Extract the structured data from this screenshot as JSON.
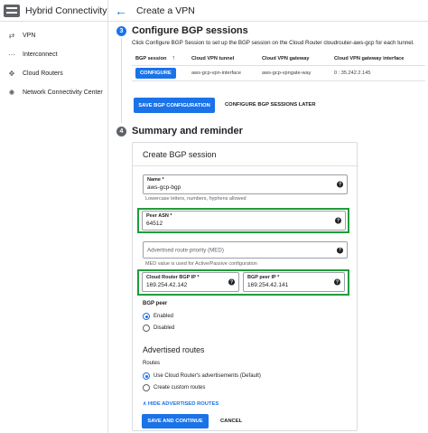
{
  "sidebar": {
    "title": "Hybrid Connectivity",
    "items": [
      {
        "label": "VPN",
        "icon": "vpn-icon"
      },
      {
        "label": "Interconnect",
        "icon": "interconnect-icon"
      },
      {
        "label": "Cloud Routers",
        "icon": "cloud-router-icon"
      },
      {
        "label": "Network Connectivity Center",
        "icon": "network-center-icon"
      }
    ]
  },
  "topbar": {
    "title": "Create a VPN"
  },
  "step3": {
    "number": "3",
    "title": "Configure BGP sessions",
    "description": "Click Configure BGP Session to set up the BGP session on the Cloud Router cloudrouter-aws-gcp for each tunnel.",
    "table": {
      "headers": [
        "BGP session",
        "Cloud VPN tunnel",
        "Cloud VPN gateway",
        "Cloud VPN gateway interface"
      ],
      "rows": [
        {
          "action": "CONFIGURE",
          "tunnel": "aws-gcp-vpn-interface",
          "gateway": "aws-gcp-vpngate-way",
          "interface": "0 : 35.242.2.145"
        }
      ]
    },
    "save_label": "SAVE BGP CONFIGURATION",
    "later_label": "CONFIGURE BGP SESSIONS LATER"
  },
  "step4": {
    "number": "4",
    "title": "Summary and reminder"
  },
  "form": {
    "title": "Create BGP session",
    "name": {
      "label": "Name *",
      "value": "aws-gcp-bgp",
      "hint": "Lowercase letters, numbers, hyphens allowed"
    },
    "peer_asn": {
      "label": "Peer ASN *",
      "value": "64512"
    },
    "med": {
      "placeholder": "Advertised route priority (MED)",
      "hint": "MED value is used for Active/Passive configuration"
    },
    "router_ip": {
      "label": "Cloud Router BGP IP *",
      "value": "169.254.42.142"
    },
    "peer_ip": {
      "label": "BGP peer IP *",
      "value": "169.254.42.141"
    },
    "bgp_peer": {
      "label": "BGP peer",
      "options": [
        "Enabled",
        "Disabled"
      ],
      "selected": "Enabled"
    },
    "advertised": {
      "title": "Advertised routes",
      "routes_label": "Routes",
      "options": [
        "Use Cloud Router's advertisements (Default)",
        "Create custom routes"
      ],
      "selected": "Use Cloud Router's advertisements (Default)",
      "hide_link": "HIDE ADVERTISED ROUTES"
    },
    "save_label": "SAVE AND CONTINUE",
    "cancel_label": "CANCEL"
  },
  "colors": {
    "accent": "#1a73e8",
    "highlight": "#1e9e3a"
  }
}
